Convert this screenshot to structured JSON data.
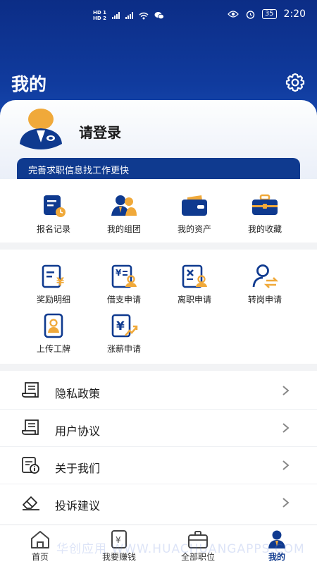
{
  "status_bar": {
    "left_indicators": "HD 5G 4G",
    "time": "2:20",
    "battery": "35"
  },
  "header": {
    "title": "我的"
  },
  "profile": {
    "login_text": "请登录",
    "tip": "完善求职信息找工作更快"
  },
  "quick_grid": [
    {
      "label": "报名记录",
      "icon": "signup-record-icon"
    },
    {
      "label": "我的组团",
      "icon": "group-icon"
    },
    {
      "label": "我的资产",
      "icon": "wallet-icon"
    },
    {
      "label": "我的收藏",
      "icon": "briefcase-icon"
    }
  ],
  "service_grid": [
    {
      "label": "奖励明细",
      "icon": "reward-detail-icon"
    },
    {
      "label": "借支申请",
      "icon": "advance-apply-icon"
    },
    {
      "label": "离职申请",
      "icon": "resign-apply-icon"
    },
    {
      "label": "转岗申请",
      "icon": "transfer-apply-icon"
    },
    {
      "label": "上传工牌",
      "icon": "upload-badge-icon"
    },
    {
      "label": "涨薪申请",
      "icon": "raise-apply-icon"
    }
  ],
  "menu": [
    {
      "label": "隐私政策",
      "icon": "privacy-doc-icon"
    },
    {
      "label": "用户协议",
      "icon": "agreement-doc-icon"
    },
    {
      "label": "关于我们",
      "icon": "about-info-icon"
    },
    {
      "label": "投诉建议",
      "icon": "feedback-eraser-icon"
    }
  ],
  "tabbar": [
    {
      "label": "首页",
      "icon": "home-icon"
    },
    {
      "label": "我要赚钱",
      "icon": "earn-money-icon"
    },
    {
      "label": "全部职位",
      "icon": "all-jobs-icon"
    },
    {
      "label": "我的",
      "icon": "profile-icon",
      "active": true
    }
  ],
  "watermark": "华创应用 WWW.HUACHUANGAPPS.COM",
  "colors": {
    "primary": "#0f3a8f",
    "accent": "#e8a93a"
  }
}
